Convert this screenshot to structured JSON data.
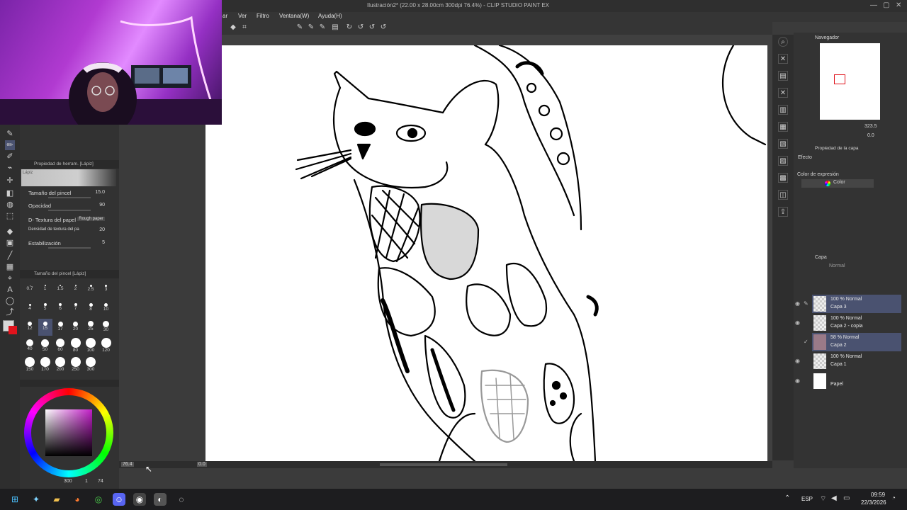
{
  "window": {
    "title": "Ilustración2* (22.00 x 28.00cm 300dpi 76.4%) - CLIP STUDIO PAINT EX"
  },
  "menu": [
    "ar",
    "Ver",
    "Filtro",
    "Ventana(W)",
    "Ayuda(H)"
  ],
  "tool_property": {
    "panel_title": "Propiedad de herram. [Lápiz]",
    "brush_name": "Lápiz",
    "rows": [
      {
        "label": "Tamaño del pincel",
        "value": "15.0"
      },
      {
        "label": "Opacidad",
        "value": "90"
      },
      {
        "label": "D- Textura del papel",
        "value": "Rough paper"
      },
      {
        "label": "Densidad de textura del pa",
        "value": "20"
      },
      {
        "label": "Estabilización",
        "value": "5"
      }
    ]
  },
  "brush_size_panel": {
    "title": "Tamaño del pincel [Lápiz]",
    "sizes": [
      "0.7",
      "1",
      "1.5",
      "2",
      "2.5",
      "3",
      "4",
      "5",
      "6",
      "7",
      "8",
      "10",
      "12",
      "15",
      "17",
      "20",
      "25",
      "30",
      "40",
      "50",
      "60",
      "80",
      "100",
      "120",
      "150",
      "170",
      "200",
      "250",
      "300"
    ],
    "selected": "15"
  },
  "color_panel": {
    "info": "300",
    "info2": "1",
    "info3": "74"
  },
  "status": {
    "zoom": "76.4",
    "angle": "0.0"
  },
  "navigator": {
    "title": "Navegador",
    "zoom": "323.5",
    "angle": "0.0"
  },
  "layer_property": {
    "title": "Propiedad de la capa",
    "effect_label": "Efecto",
    "expression_label": "Color de expresión",
    "expression_value": "Color"
  },
  "layers_panel": {
    "title": "Capa",
    "blend_mode": "Normal",
    "layers": [
      {
        "mode": "100 % Normal",
        "name": "Capa 3",
        "selected": true
      },
      {
        "mode": "100 % Normal",
        "name": "Capa 2 - copia",
        "selected": false
      },
      {
        "mode": "58 % Normal",
        "name": "Capa 2",
        "selected": true
      },
      {
        "mode": "100 % Normal",
        "name": "Capa 1",
        "selected": false
      },
      {
        "mode": "",
        "name": "Papel",
        "selected": false
      }
    ]
  },
  "taskbar": {
    "language": "ESP",
    "time": "09:59",
    "date": "22/3/2026"
  },
  "colors": {
    "accent": "#4a5270",
    "active_color": "#e0131c"
  }
}
